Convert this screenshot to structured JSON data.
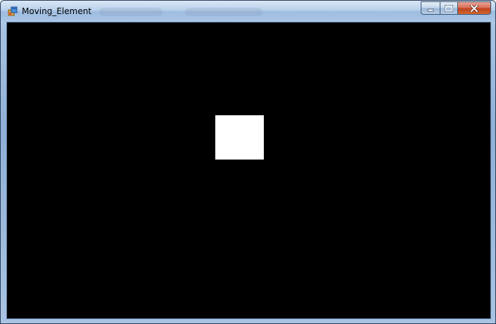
{
  "window": {
    "title": "Moving_Element",
    "icon": "windows-form-icon"
  },
  "caption_buttons": {
    "minimize_icon": "minimize-icon",
    "maximize_icon": "maximize-icon",
    "close_icon": "close-icon"
  },
  "client": {
    "background_color": "#000000",
    "element_color": "#ffffff"
  }
}
